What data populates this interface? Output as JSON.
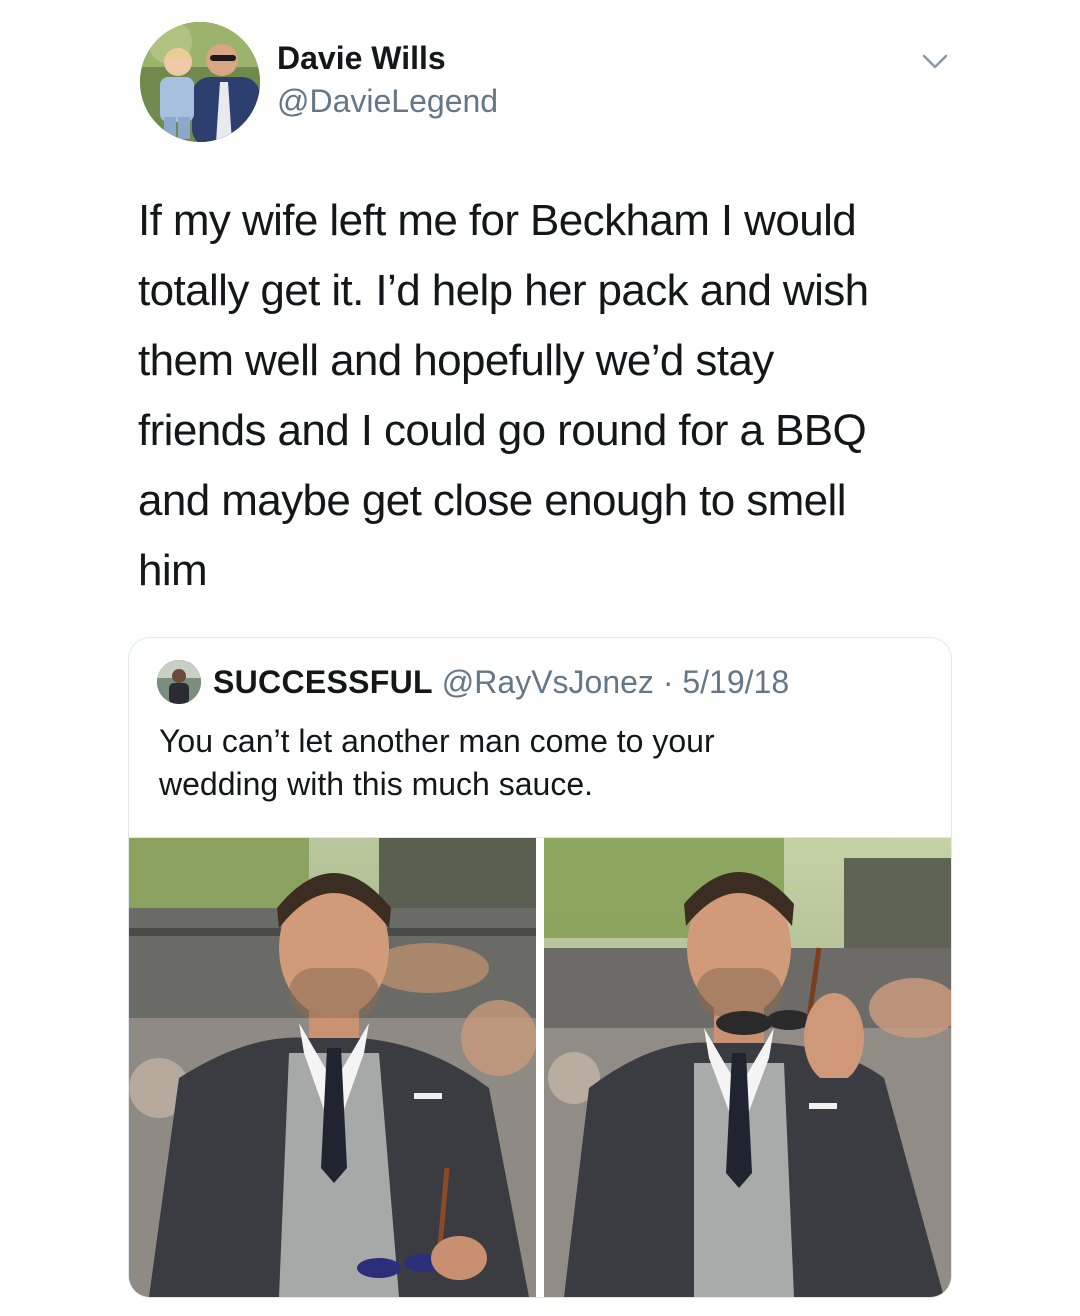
{
  "tweet": {
    "author_name": "Davie Wills",
    "author_handle": "@DavieLegend",
    "text_lines": [
      "If my wife left me for Beckham I would",
      "totally get it. I’d help her pack and wish",
      "them well and hopefully we’d stay",
      "friends and I could go round for a BBQ",
      "and maybe get close enough to smell",
      "him"
    ],
    "menu_icon": "chevron-down-icon"
  },
  "quoted_tweet": {
    "author_name": "SUCCESSFUL",
    "author_handle": "@RayVsJonez",
    "separator": " · ",
    "date": "5/19/18",
    "text_lines": [
      "You can’t let another man come to your",
      "wedding with this much sauce."
    ],
    "photo_count": 2
  },
  "colors": {
    "text_primary": "#14171a",
    "text_secondary": "#657786",
    "border": "#e1e8ed"
  }
}
